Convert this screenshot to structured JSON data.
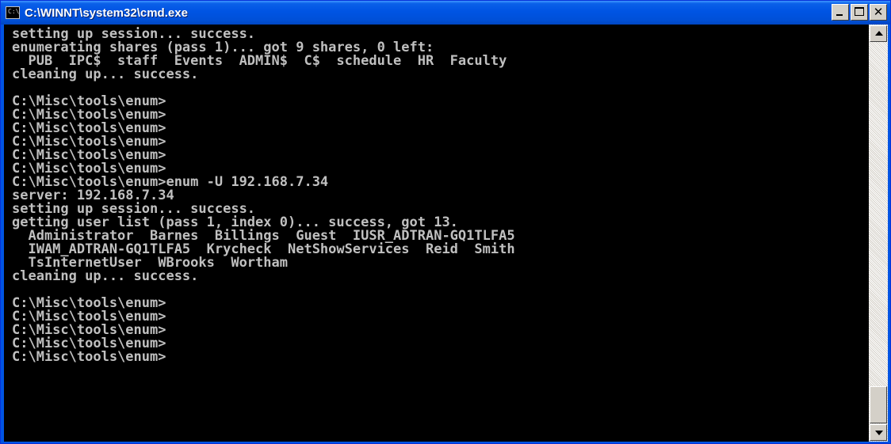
{
  "window": {
    "title": "C:\\WINNT\\system32\\cmd.exe",
    "icon": "console-icon",
    "icon_text": "C:\\"
  },
  "caption_buttons": {
    "minimize_icon": "minimize-icon",
    "maximize_icon": "maximize-icon",
    "close_icon": "close-icon",
    "close_glyph": "✕"
  },
  "console": {
    "background": "#000000",
    "foreground": "#c0c0c0",
    "lines": [
      "setting up session... success.",
      "enumerating shares (pass 1)... got 9 shares, 0 left:",
      "  PUB  IPC$  staff  Events  ADMIN$  C$  schedule  HR  Faculty",
      "cleaning up... success.",
      "",
      "C:\\Misc\\tools\\enum>",
      "C:\\Misc\\tools\\enum>",
      "C:\\Misc\\tools\\enum>",
      "C:\\Misc\\tools\\enum>",
      "C:\\Misc\\tools\\enum>",
      "C:\\Misc\\tools\\enum>",
      "C:\\Misc\\tools\\enum>enum -U 192.168.7.34",
      "server: 192.168.7.34",
      "setting up session... success.",
      "getting user list (pass 1, index 0)... success, got 13.",
      "  Administrator  Barnes  Billings  Guest  IUSR_ADTRAN-GQ1TLFA5",
      "  IWAM_ADTRAN-GQ1TLFA5  Krycheck  NetShowServices  Reid  Smith",
      "  TsInternetUser  WBrooks  Wortham",
      "cleaning up... success.",
      "",
      "C:\\Misc\\tools\\enum>",
      "C:\\Misc\\tools\\enum>",
      "C:\\Misc\\tools\\enum>",
      "C:\\Misc\\tools\\enum>",
      "C:\\Misc\\tools\\enum>"
    ]
  },
  "scrollbar": {
    "up_icon": "scroll-up-arrow-icon",
    "down_icon": "scroll-down-arrow-icon",
    "position_fraction": 0.95
  }
}
